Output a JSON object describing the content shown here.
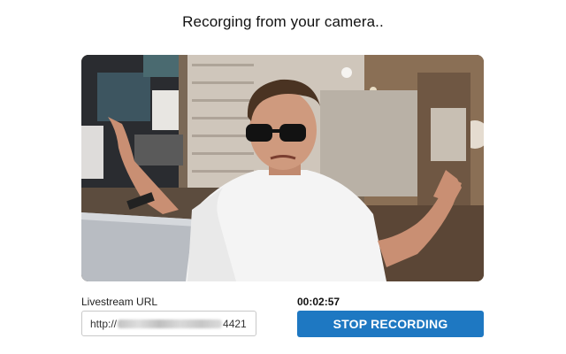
{
  "page": {
    "title": "Recorging from your camera.."
  },
  "video": {
    "icon": "camera-feed"
  },
  "stream": {
    "url_label": "Livestream URL",
    "url_prefix": "http://",
    "url_suffix": "4421"
  },
  "recording": {
    "elapsed": "00:02:57",
    "stop_label": "STOP RECORDING"
  },
  "colors": {
    "button_bg": "#1e78c2",
    "button_text": "#ffffff"
  }
}
